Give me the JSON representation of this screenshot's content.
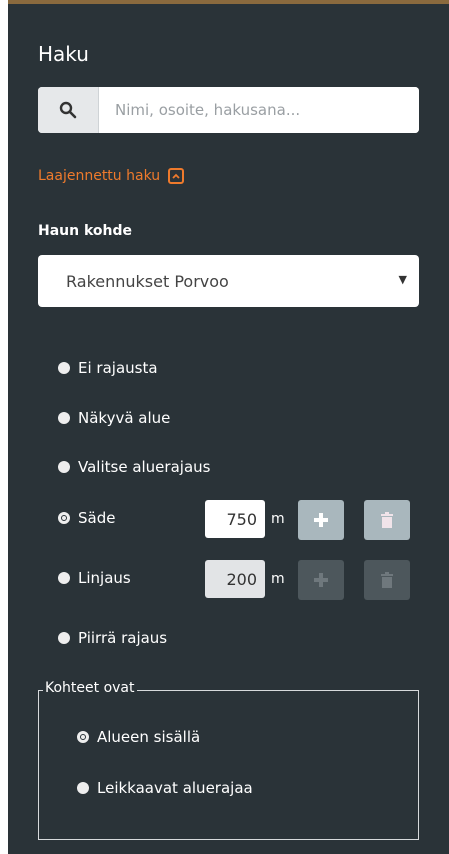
{
  "panel": {
    "title": "Haku",
    "search": {
      "placeholder": "Nimi, osoite, hakusana...",
      "icon": "search-icon"
    },
    "advanced_toggle": "Laajennettu haku",
    "target_label": "Haun kohde",
    "target_select": {
      "value": "Rakennukset Porvoo"
    },
    "options": [
      {
        "label": "Ei rajausta",
        "selected": false
      },
      {
        "label": "Näkyvä alue",
        "selected": false
      },
      {
        "label": "Valitse aluerajaus",
        "selected": false
      },
      {
        "label": "Säde",
        "selected": true,
        "value": "750",
        "unit": "m"
      },
      {
        "label": "Linjaus",
        "selected": false,
        "value": "200",
        "unit": "m"
      },
      {
        "label": "Piirrä rajaus",
        "selected": false
      }
    ],
    "objects": {
      "legend": "Kohteet ovat",
      "options": [
        {
          "label": "Alueen sisällä",
          "selected": true
        },
        {
          "label": "Leikkaavat aluerajaa",
          "selected": false
        }
      ]
    }
  },
  "colors": {
    "panel_bg": "#2a3338",
    "accent": "#ee7a2c"
  }
}
